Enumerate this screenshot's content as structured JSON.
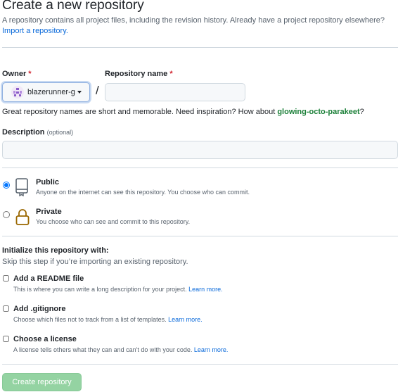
{
  "header": {
    "title": "Create a new repository",
    "subtitle": "A repository contains all project files, including the revision history. Already have a project repository elsewhere?",
    "import_link": "Import a repository."
  },
  "owner": {
    "label": "Owner",
    "required_mark": "*",
    "value": "blazerunner-g",
    "avatar_icon": "identicon"
  },
  "separator": "/",
  "repo_name": {
    "label": "Repository name",
    "required_mark": "*",
    "value": "",
    "placeholder": ""
  },
  "name_hint": {
    "text": "Great repository names are short and memorable. Need inspiration? How about",
    "suggestion": "glowing-octo-parakeet",
    "suffix": "?"
  },
  "description": {
    "label": "Description",
    "optional": "(optional)",
    "value": "",
    "placeholder": ""
  },
  "visibility": {
    "selected": "public",
    "options": [
      {
        "id": "public",
        "title": "Public",
        "description": "Anyone on the internet can see this repository. You choose who can commit.",
        "icon": "repo-book-icon"
      },
      {
        "id": "private",
        "title": "Private",
        "description": "You choose who can see and commit to this repository.",
        "icon": "lock-icon"
      }
    ]
  },
  "initialize": {
    "title": "Initialize this repository with:",
    "subtitle": "Skip this step if you’re importing an existing repository.",
    "options": [
      {
        "title": "Add a README file",
        "description": "This is where you can write a long description for your project.",
        "link": "Learn more.",
        "checked": false
      },
      {
        "title": "Add .gitignore",
        "description": "Choose which files not to track from a list of templates.",
        "link": "Learn more.",
        "checked": false
      },
      {
        "title": "Choose a license",
        "description": "A license tells others what they can and can't do with your code.",
        "link": "Learn more.",
        "checked": false
      }
    ]
  },
  "submit": {
    "label": "Create repository",
    "disabled": true
  },
  "colors": {
    "link": "#0969da",
    "suggestion": "#1a7f37",
    "required": "#d1242f",
    "submit_disabled_bg": "#94d3a2",
    "lock_icon": "#9a6700"
  }
}
